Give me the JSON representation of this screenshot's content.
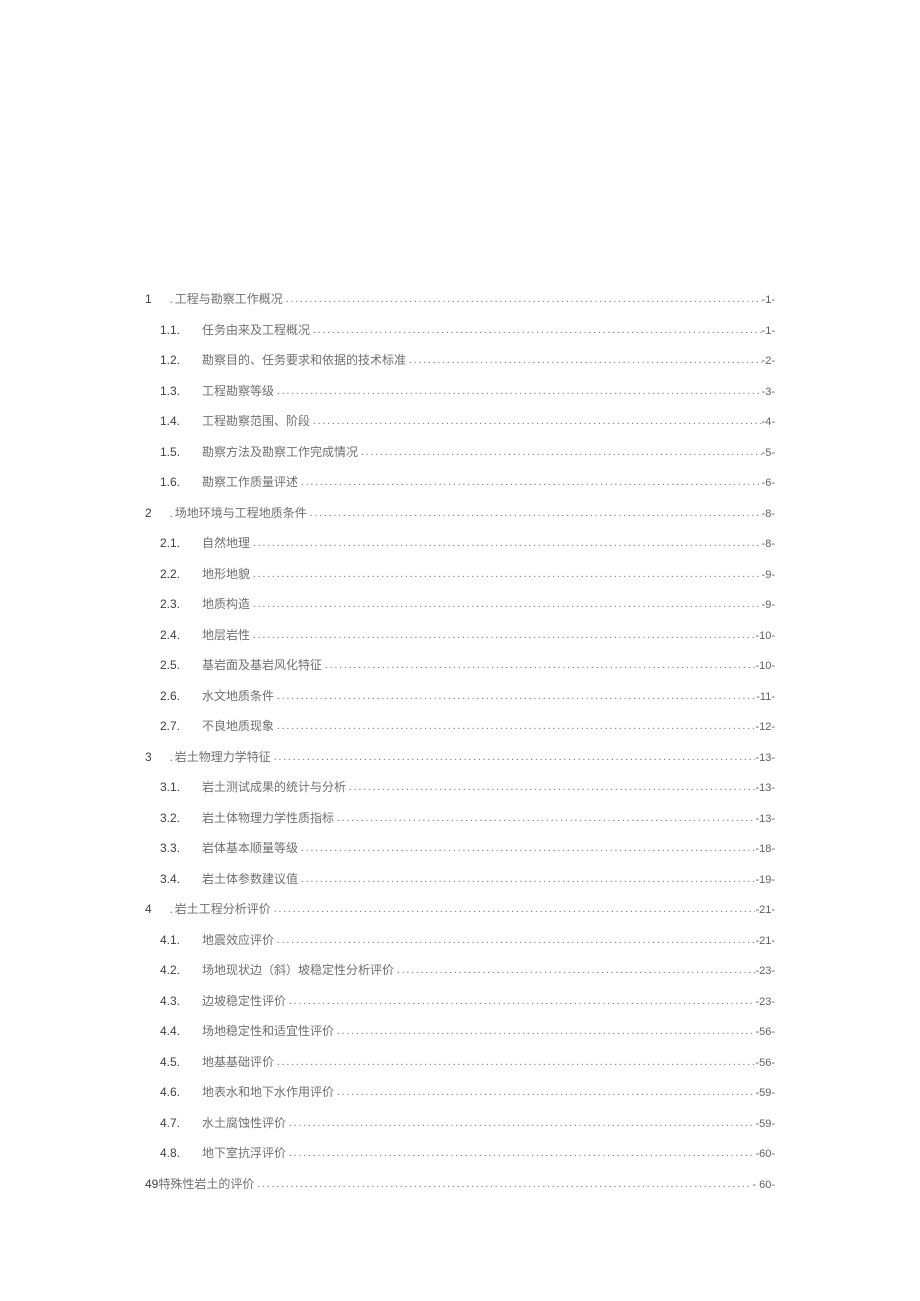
{
  "toc": [
    {
      "level": 1,
      "num": "1",
      "dot": ".",
      "title": "工程与勘察工作概况",
      "page": "-1-"
    },
    {
      "level": 2,
      "num": "1.1.",
      "title": "任务由来及工程概况",
      "page": "-1-"
    },
    {
      "level": 2,
      "num": "1.2.",
      "title": "勘察目的、任务要求和依据的技术标准",
      "page": "-2-"
    },
    {
      "level": 2,
      "num": "1.3.",
      "title": "工程勘察等级",
      "page": "-3-"
    },
    {
      "level": 2,
      "num": "1.4.",
      "title": "工程勘察范围、阶段",
      "page": "-4-"
    },
    {
      "level": 2,
      "num": "1.5.",
      "title": "勘察方法及勘察工作完成情况",
      "page": "-5-"
    },
    {
      "level": 2,
      "num": "1.6.",
      "title": "勘察工作质量评述",
      "page": "-6-"
    },
    {
      "level": 1,
      "num": "2",
      "dot": ".",
      "title": "场地环境与工程地质条件",
      "page": "-8-"
    },
    {
      "level": 2,
      "num": "2.1.",
      "title": "自然地理",
      "page": "-8-"
    },
    {
      "level": 2,
      "num": "2.2.",
      "title": "地形地貌",
      "page": "-9-"
    },
    {
      "level": 2,
      "num": "2.3.",
      "title": "地质构造",
      "page": "-9-"
    },
    {
      "level": 2,
      "num": "2.4.",
      "title": "地层岩性",
      "page": "-10-"
    },
    {
      "level": 2,
      "num": "2.5.",
      "title": "基岩面及基岩风化特征",
      "page": "-10-"
    },
    {
      "level": 2,
      "num": "2.6.",
      "title": "水文地质条件",
      "page": "-11-"
    },
    {
      "level": 2,
      "num": "2.7.",
      "title": "不良地质现象",
      "page": "-12-"
    },
    {
      "level": 1,
      "num": "3",
      "dot": ".",
      "title": "岩土物理力学特征",
      "page": "-13-"
    },
    {
      "level": 2,
      "num": "3.1.",
      "title": "岩土测试成果的统计与分析",
      "page": "-13-"
    },
    {
      "level": 2,
      "num": "3.2.",
      "title": "岩土体物理力学性质指标",
      "page": "-13-"
    },
    {
      "level": 2,
      "num": "3.3.",
      "title": "岩体基本顺量等级",
      "page": "-18-"
    },
    {
      "level": 2,
      "num": "3.4.",
      "title": "岩土体参数建议值",
      "page": "-19-"
    },
    {
      "level": 1,
      "num": "4",
      "dot": ".",
      "title": "岩土工程分析评价",
      "page": "-21-"
    },
    {
      "level": 2,
      "num": "4.1.",
      "title": "地震效应评价",
      "page": "-21-"
    },
    {
      "level": 2,
      "num": "4.2.",
      "title": "场地现状边（斜）坡稳定性分析评价",
      "page": "-23-"
    },
    {
      "level": 2,
      "num": "4.3.",
      "title": "边坡稳定性评价",
      "page": "-23-"
    },
    {
      "level": 2,
      "num": "4.4.",
      "title": "场地稳定性和适宜性评价",
      "page": "-56-"
    },
    {
      "level": 2,
      "num": "4.5.",
      "title": "地基基础评价",
      "page": "-56-"
    },
    {
      "level": 2,
      "num": "4.6.",
      "title": "地表水和地下水作用评价",
      "page": "-59-"
    },
    {
      "level": 2,
      "num": "4.7.",
      "title": "水土腐蚀性评价",
      "page": "-59-"
    },
    {
      "level": 2,
      "num": "4.8.",
      "title": "地下室抗浮评价",
      "page": "-60-"
    },
    {
      "level": "special",
      "num": "49",
      "title": "特殊性岩土的评价",
      "page": "- 60-"
    }
  ]
}
